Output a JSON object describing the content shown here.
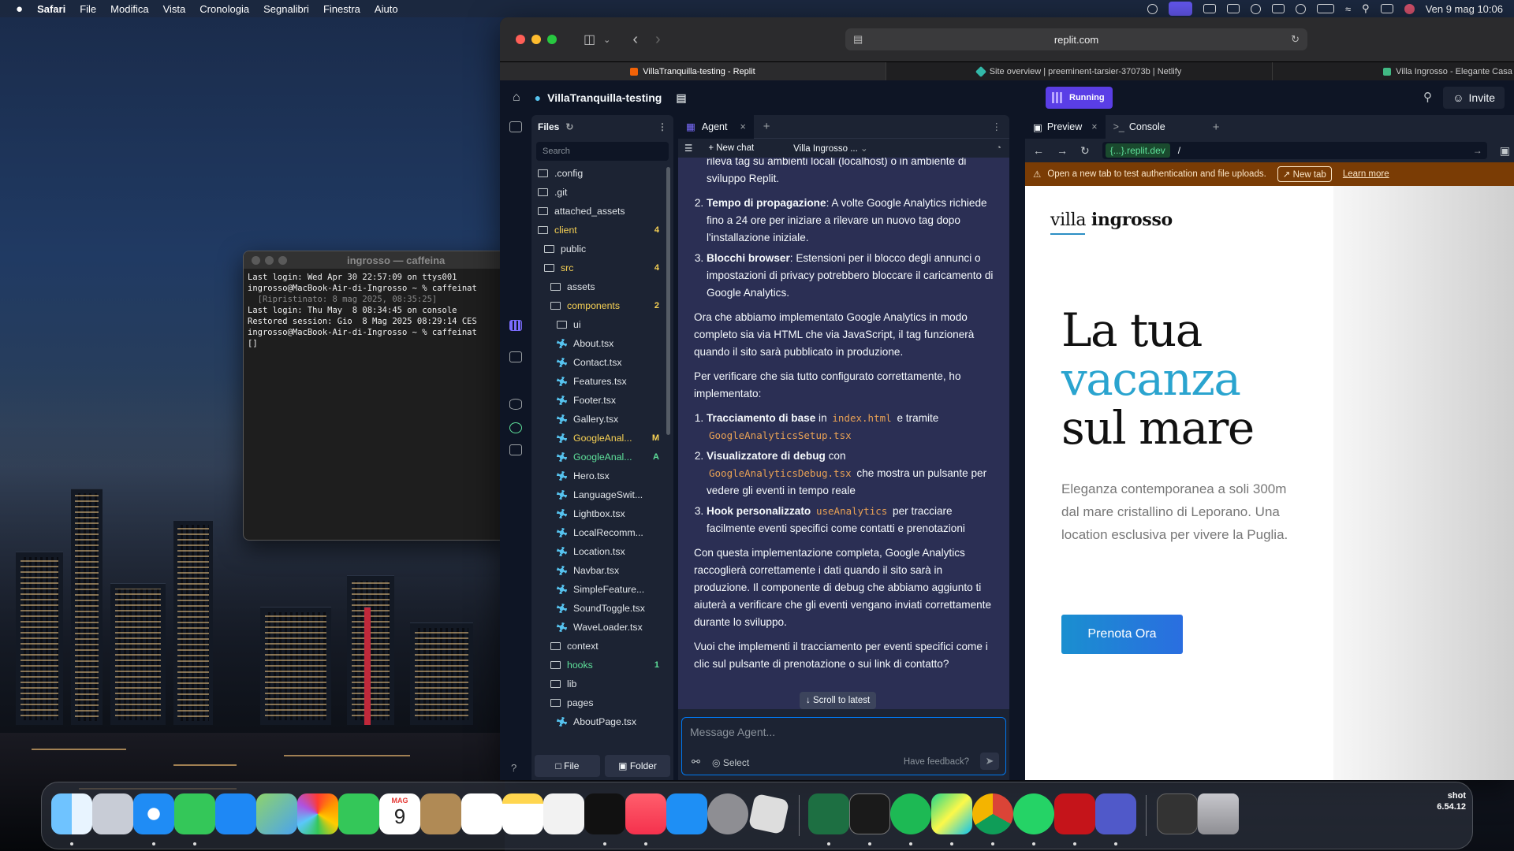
{
  "menubar": {
    "apple": "",
    "app": "Safari",
    "items": [
      "File",
      "Modifica",
      "Vista",
      "Cronologia",
      "Segnalibri",
      "Finestra",
      "Aiuto"
    ],
    "datetime": "Ven 9 mag  10:06"
  },
  "terminal": {
    "title": "ingrosso — caffeina",
    "lines": [
      "Last login: Wed Apr 30 22:57:09 on ttys001",
      "ingrosso@MacBook-Air-di-Ingrosso ~ % caffeinat",
      "  [Ripristinato: 8 mag 2025, 08:35:25]",
      "Last login: Thu May  8 08:34:45 on console",
      "Restored session: Gio  8 Mag 2025 08:29:14 CES",
      "ingrosso@MacBook-Air-di-Ingrosso ~ % caffeinat",
      "[]"
    ]
  },
  "browser": {
    "url": "replit.com",
    "tabs": [
      {
        "label": "VillaTranquilla-testing - Replit",
        "color": "#f26207"
      },
      {
        "label": "Site overview | preeminent-tarsier-37073b | Netlify",
        "color": "#32b8a8"
      },
      {
        "label": "Villa Ingrosso - Elegante Casa Vacanze",
        "color": "#41b883"
      }
    ]
  },
  "replit": {
    "project": "VillaTranquilla-testing",
    "status": "Running",
    "invite": "Invite",
    "files": {
      "title": "Files",
      "search": "Search",
      "file_btn": "File",
      "folder_btn": "Folder",
      "help": "?",
      "tree": [
        {
          "name": ".config",
          "type": "folder",
          "indent": 0
        },
        {
          "name": ".git",
          "type": "folder",
          "indent": 0
        },
        {
          "name": "attached_assets",
          "type": "folder",
          "indent": 0
        },
        {
          "name": "client",
          "type": "folder",
          "indent": 0,
          "badge": "4",
          "color": "yellow"
        },
        {
          "name": "public",
          "type": "folder",
          "indent": 1
        },
        {
          "name": "src",
          "type": "folder",
          "indent": 1,
          "badge": "4",
          "color": "yellow"
        },
        {
          "name": "assets",
          "type": "folder",
          "indent": 2
        },
        {
          "name": "components",
          "type": "folder",
          "indent": 2,
          "badge": "2",
          "color": "yellow"
        },
        {
          "name": "ui",
          "type": "folder",
          "indent": 3
        },
        {
          "name": "About.tsx",
          "type": "file",
          "indent": 3
        },
        {
          "name": "Contact.tsx",
          "type": "file",
          "indent": 3
        },
        {
          "name": "Features.tsx",
          "type": "file",
          "indent": 3
        },
        {
          "name": "Footer.tsx",
          "type": "file",
          "indent": 3
        },
        {
          "name": "Gallery.tsx",
          "type": "file",
          "indent": 3
        },
        {
          "name": "GoogleAnal...",
          "type": "file",
          "indent": 3,
          "badge": "M",
          "color": "yellow"
        },
        {
          "name": "GoogleAnal...",
          "type": "file",
          "indent": 3,
          "badge": "A",
          "color": "green"
        },
        {
          "name": "Hero.tsx",
          "type": "file",
          "indent": 3
        },
        {
          "name": "LanguageSwit...",
          "type": "file",
          "indent": 3
        },
        {
          "name": "Lightbox.tsx",
          "type": "file",
          "indent": 3
        },
        {
          "name": "LocalRecomm...",
          "type": "file",
          "indent": 3
        },
        {
          "name": "Location.tsx",
          "type": "file",
          "indent": 3
        },
        {
          "name": "Navbar.tsx",
          "type": "file",
          "indent": 3
        },
        {
          "name": "SimpleFeature...",
          "type": "file",
          "indent": 3
        },
        {
          "name": "SoundToggle.tsx",
          "type": "file",
          "indent": 3
        },
        {
          "name": "WaveLoader.tsx",
          "type": "file",
          "indent": 3
        },
        {
          "name": "context",
          "type": "folder",
          "indent": 2
        },
        {
          "name": "hooks",
          "type": "folder",
          "indent": 2,
          "badge": "1",
          "color": "green"
        },
        {
          "name": "lib",
          "type": "folder",
          "indent": 2
        },
        {
          "name": "pages",
          "type": "folder",
          "indent": 2
        },
        {
          "name": "AboutPage.tsx",
          "type": "file",
          "indent": 3
        }
      ]
    },
    "agent": {
      "tab": "Agent",
      "new_chat": "New chat",
      "chat_name": "Villa Ingrosso ...",
      "placeholder": "Message Agent...",
      "select": "Select",
      "feedback": "Have feedback?",
      "scroll_latest": "Scroll to latest",
      "p_top": "rileva tag su ambienti locali (localhost) o in ambiente di sviluppo Replit.",
      "list1": [
        {
          "b": "Tempo di propagazione",
          "t": ": A volte Google Analytics richiede fino a 24 ore per iniziare a rilevare un nuovo tag dopo l'installazione iniziale."
        },
        {
          "b": "Blocchi browser",
          "t": ": Estensioni per il blocco degli annunci o impostazioni di privacy potrebbero bloccare il caricamento di Google Analytics."
        }
      ],
      "p1": "Ora che abbiamo implementato Google Analytics in modo completo sia via HTML che via JavaScript, il tag funzionerà quando il sito sarà pubblicato in produzione.",
      "p2": "Per verificare che sia tutto configurato correttamente, ho implementato:",
      "l2_1b": "Tracciamento di base",
      "l2_1a": " in ",
      "l2_1c": "index.html",
      "l2_1d": " e tramite ",
      "l2_1e": "GoogleAnalyticsSetup.tsx",
      "l2_2b": "Visualizzatore di debug",
      "l2_2a": " con ",
      "l2_2c": "GoogleAnalyticsDebug.tsx",
      "l2_2d": " che mostra un pulsante per vedere gli eventi in tempo reale",
      "l2_3b": "Hook personalizzato",
      "l2_3c": "useAnalytics",
      "l2_3d": " per tracciare facilmente eventi specifici come contatti e prenotazioni",
      "p3": "Con questa implementazione completa, Google Analytics raccoglierà correttamente i dati quando il sito sarà in produzione. Il componente di debug che abbiamo aggiunto ti aiuterà a verificare che gli eventi vengano inviati correttamente durante lo sviluppo.",
      "p4": "Vuoi che implementi il tracciamento per eventi specifici come i clic sul pulsante di prenotazione o sui link di contatto?"
    },
    "preview": {
      "tab": "Preview",
      "console": "Console",
      "domain": "{...}.replit.dev",
      "path": "/",
      "warning": "Open a new tab to test authentication and file uploads.",
      "new_tab": "New tab",
      "learn_more": "Learn more"
    }
  },
  "site": {
    "logo_a": "villa",
    "logo_b": "ingrosso",
    "h1_a": "La tua",
    "h1_b": "vacanza",
    "h1_c": "sul mare",
    "text": "Eleganza contemporanea a soli 300m dal mare cristallino di Leporano. Una location esclusiva per vivere la Puglia.",
    "cta": "Prenota Ora"
  },
  "dock": {
    "calendar_month": "MAG",
    "calendar_day": "9",
    "screenshot_label": "shot",
    "screenshot_time": "6.54.12"
  }
}
